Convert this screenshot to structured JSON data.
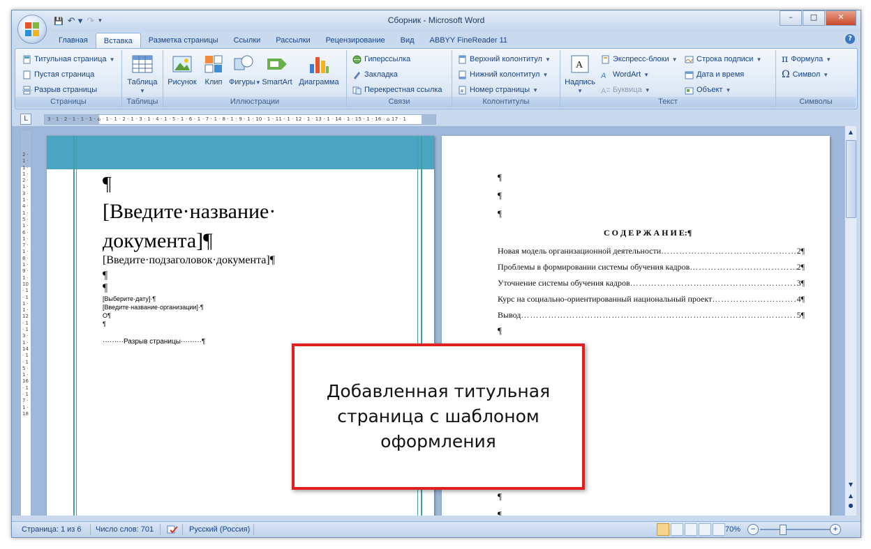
{
  "window": {
    "title": "Сборник - Microsoft Word",
    "controls": {
      "minimize": "–",
      "maximize": "□",
      "close": "✕"
    }
  },
  "qat": {
    "save": "💾",
    "undo": "↶ ▾",
    "redo": "↷",
    "customize": "▾"
  },
  "tabs": [
    "Главная",
    "Вставка",
    "Разметка страницы",
    "Ссылки",
    "Рассылки",
    "Рецензирование",
    "Вид",
    "ABBYY FineReader 11"
  ],
  "active_tab": "Вставка",
  "help": "?",
  "ribbon": {
    "pages": {
      "label": "Страницы",
      "items": [
        "Титульная страница",
        "Пустая страница",
        "Разрыв страницы"
      ]
    },
    "tables": {
      "label": "Таблицы",
      "items": [
        "Таблица"
      ]
    },
    "illustrations": {
      "label": "Иллюстрации",
      "items": [
        "Рисунок",
        "Клип",
        "Фигуры",
        "SmartArt",
        "Диаграмма"
      ]
    },
    "links": {
      "label": "Связи",
      "items": [
        "Гиперссылка",
        "Закладка",
        "Перекрестная ссылка"
      ]
    },
    "headers": {
      "label": "Колонтитулы",
      "items": [
        "Верхний колонтитул",
        "Нижний колонтитул",
        "Номер страницы"
      ]
    },
    "text": {
      "label": "Текст",
      "items": [
        "Надпись",
        "Экспресс-блоки",
        "WordArt",
        "Буквица",
        "Строка подписи",
        "Дата и время",
        "Объект"
      ]
    },
    "symbols": {
      "label": "Символы",
      "items": [
        "Формула",
        "Символ"
      ]
    }
  },
  "ruler": {
    "corner": "L",
    "text": "3 · 1 · 2 · 1 · 1 · 1 · ⌂ · 1 · 1 · 2 · 1 · 3 · 1 · 4 · 1 · 5 · 1 · 6 · 1 · 7 · 1 · 8 · 1 · 9 · 1 · 10 · 1 · 11 · 1 · 12 · 1 · 13 · 1 · 14 · 1 · 15 · 1 · 16 · ⌂ 17 · 1",
    "vtext": "2 · 1 · 1 · 1 · 2 · 1 · 3 · 1 · 4 · 1 · 5 · 1 · 6 · 1 · 7 · 1 · 8 · 1 · 9 · 1 · 10 · 1 · 11 · 1 · 12 · 1 · 13 · 1 · 14 · 1 · 15 · 1 · 16 · 1 · 17 · 1 · 18"
  },
  "page1": {
    "pilcrow_top": "¶",
    "title_line1": "[Введите·название·",
    "title_line2": "документа]¶",
    "subtitle": "[Введите·подзаголовок·документа]¶",
    "p1": "¶",
    "p2": "¶",
    "date": "[Выберите·дату]·¶",
    "org": "[Введите·название·организации]·¶",
    "o": "О¶",
    "p3": "¶",
    "page_break": "·········Разрыв страницы·········¶"
  },
  "page2": {
    "p1": "¶",
    "p2": "¶",
    "p3": "¶",
    "heading": "С О Д Е Р Ж А Н И Е:¶",
    "toc": [
      {
        "title": "Новая модель организационной деятельности",
        "page": "2¶"
      },
      {
        "title": "Проблемы в формировании системы обучения кадров",
        "page": "2¶"
      },
      {
        "title": "Уточнение системы обучения кадров",
        "page": "3¶"
      },
      {
        "title": "Курс на социально-ориентированный национальный проект",
        "page": "4¶"
      },
      {
        "title": "Вывод",
        "page": "5¶"
      }
    ],
    "p_after": "¶",
    "p_bottom1": "¶",
    "p_bottom2": "¶"
  },
  "callout": {
    "text": "Добавленная титульная\nстраница с шаблоном\nоформления"
  },
  "statusbar": {
    "page": "Страница: 1 из 6",
    "words": "Число слов: 701",
    "lang": "Русский (Россия)",
    "zoom": "70%",
    "zoom_minus": "−",
    "zoom_plus": "+"
  },
  "colors": {
    "accent_band": "#4aa5c2",
    "callout_border": "#e0201e",
    "ribbon_text": "#15428b"
  }
}
